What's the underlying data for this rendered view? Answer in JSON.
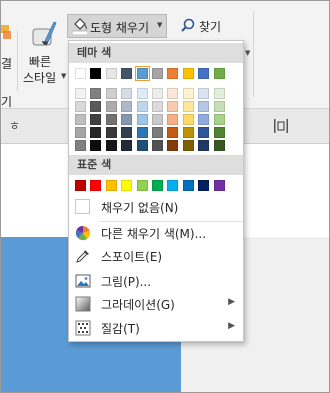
{
  "ribbon": {
    "left_partial_label": "결",
    "quick_styles_label_1": "빠른",
    "quick_styles_label_2": "스타일",
    "left_group_tail": "기",
    "shape_fill_label": "도형 채우기",
    "find_label": "찾기",
    "ruler_char": "ㅎ"
  },
  "dropdown": {
    "theme_colors_title": "테마 색",
    "standard_colors_title": "표준 색",
    "no_fill_label": "채우기 없음(N)",
    "items": [
      {
        "label": "다른 채우기 색(M)...",
        "icon": "color-wheel-icon",
        "submenu": false
      },
      {
        "label": "스포이트(E)",
        "icon": "eyedropper-icon",
        "submenu": false
      },
      {
        "label": "그림(P)...",
        "icon": "picture-icon",
        "submenu": false
      },
      {
        "label": "그라데이션(G)",
        "icon": "gradient-icon",
        "submenu": true
      },
      {
        "label": "질감(T)",
        "icon": "texture-icon",
        "submenu": true
      }
    ],
    "theme_colors": [
      [
        "#ffffff",
        "#f2f2f2",
        "#d9d9d9",
        "#bfbfbf",
        "#a6a6a6",
        "#808080"
      ],
      [
        "#000000",
        "#808080",
        "#595959",
        "#404040",
        "#262626",
        "#0d0d0d"
      ],
      [
        "#e7e6e6",
        "#d0cece",
        "#afabab",
        "#767171",
        "#3a3838",
        "#171616"
      ],
      [
        "#44546a",
        "#d6dce5",
        "#adb9ca",
        "#8497b0",
        "#333f50",
        "#222a35"
      ],
      [
        "#5b9bd5",
        "#deebf7",
        "#bdd7ee",
        "#9dc3e6",
        "#2e75b6",
        "#1f4e79"
      ],
      [
        "#a5a5a5",
        "#ededed",
        "#dbdbdb",
        "#c9c9c9",
        "#7c7c7c",
        "#525252"
      ],
      [
        "#ed7d31",
        "#fbe5d6",
        "#f8cbad",
        "#f4b183",
        "#c55a11",
        "#843c0c"
      ],
      [
        "#ffc000",
        "#fff2cc",
        "#ffe699",
        "#ffd966",
        "#bf9000",
        "#7f6000"
      ],
      [
        "#4472c4",
        "#dae3f3",
        "#b4c7e7",
        "#8faadc",
        "#2f5597",
        "#203864"
      ],
      [
        "#70ad47",
        "#e2f0d9",
        "#c5e0b4",
        "#a9d18e",
        "#548235",
        "#385723"
      ]
    ],
    "selected_theme_color": "#5b9bd5",
    "standard_colors": [
      "#c00000",
      "#ff0000",
      "#ffc000",
      "#ffff00",
      "#92d050",
      "#00b050",
      "#00b0f0",
      "#0070c0",
      "#002060",
      "#7030a0"
    ]
  },
  "canvas": {
    "shape_color": "#5b9bd5"
  }
}
